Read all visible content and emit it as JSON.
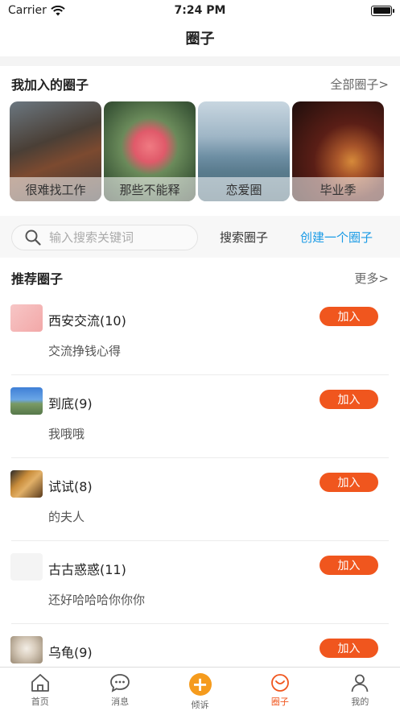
{
  "status_bar": {
    "carrier": "Carrier",
    "time": "7:24 PM"
  },
  "nav": {
    "title": "圈子"
  },
  "joined": {
    "title": "我加入的圈子",
    "all_link": "全部圈子>",
    "cards": [
      {
        "caption": "很难找工作",
        "icon": "office-photo"
      },
      {
        "caption": "那些不能释",
        "icon": "flower-photo"
      },
      {
        "caption": "恋爱圈",
        "icon": "lake-photo"
      },
      {
        "caption": "毕业季",
        "icon": "guitar-photo"
      }
    ]
  },
  "search": {
    "placeholder": "输入搜索关键词",
    "search_label": "搜索圈子",
    "create_label": "创建一个圈子"
  },
  "recommended": {
    "title": "推荐圈子",
    "more_link": "更多>",
    "join_label": "加入",
    "items": [
      {
        "name": "西安交流(10)",
        "desc": "交流挣钱心得"
      },
      {
        "name": "到底(9)",
        "desc": "我哦哦"
      },
      {
        "name": "试试(8)",
        "desc": "的夫人"
      },
      {
        "name": "古古惑惑(11)",
        "desc": "还好哈哈哈你你你"
      },
      {
        "name": "乌龟(9)",
        "desc": ""
      }
    ]
  },
  "tab_bar": {
    "tabs": [
      {
        "label": "首页",
        "icon": "home-icon"
      },
      {
        "label": "消息",
        "icon": "message-icon"
      },
      {
        "label": "倾诉",
        "icon": "plus-icon"
      },
      {
        "label": "圈子",
        "icon": "circle-icon"
      },
      {
        "label": "我的",
        "icon": "person-icon"
      }
    ],
    "active_index": 3
  },
  "colors": {
    "accent": "#f0561e",
    "link": "#1a9be6",
    "plus": "#f59b1d"
  }
}
